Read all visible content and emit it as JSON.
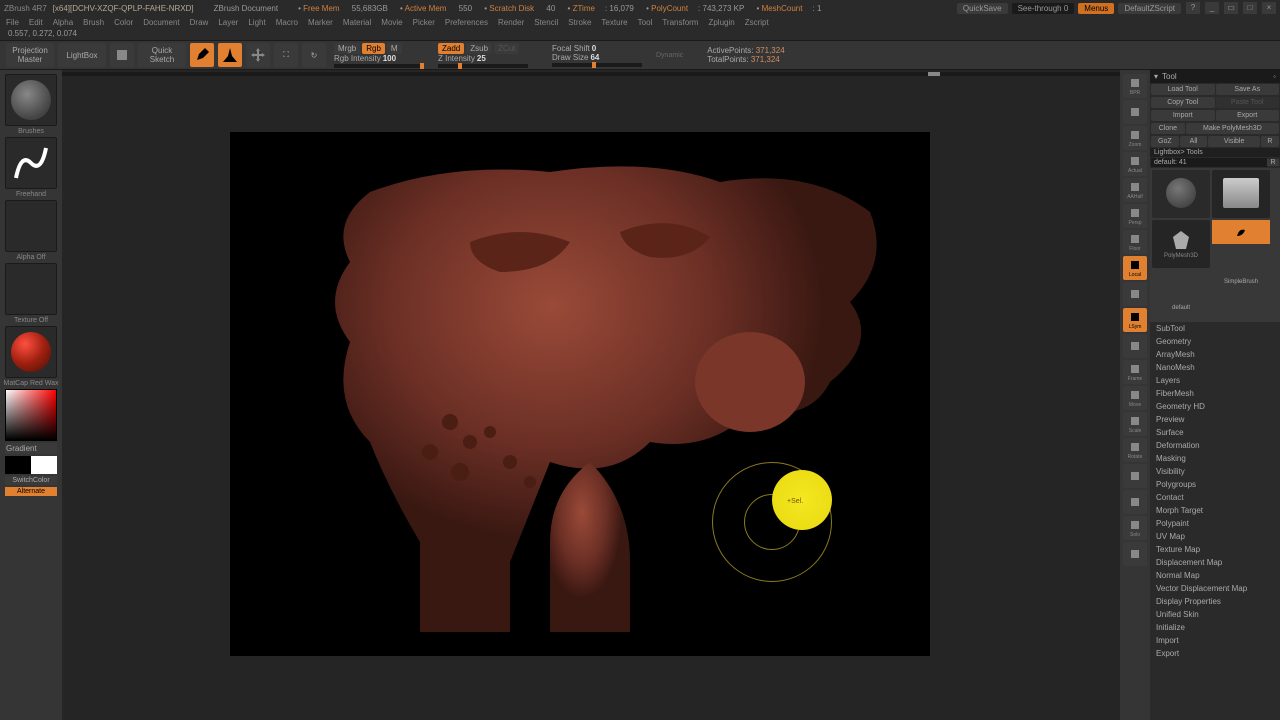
{
  "titlebar": {
    "app": "ZBrush 4R7",
    "file": "[x64][DCHV-XZQF-QPLP-FAHE-NRXD]",
    "docname": "ZBrush Document",
    "stats": {
      "freemem_lbl": "Free Mem",
      "freemem": "55,683GB",
      "activemem_lbl": "Active Mem",
      "activemem": "550",
      "scratch_lbl": "Scratch Disk",
      "scratch": "40",
      "ztime_lbl": "ZTime",
      "ztime": "16,079",
      "polycount_lbl": "PolyCount",
      "polycount": "743,273 KP",
      "meshcount_lbl": "MeshCount",
      "meshcount": "1"
    },
    "right": {
      "quicksave": "QuickSave",
      "seethrough": "See-through",
      "seethrough_val": "0",
      "menus": "Menus",
      "script": "DefaultZScript"
    }
  },
  "menus": [
    "File",
    "Edit",
    "Alpha",
    "Brush",
    "Color",
    "Document",
    "Draw",
    "Layer",
    "Light",
    "Macro",
    "Marker",
    "Material",
    "Movie",
    "Picker",
    "Preferences",
    "Render",
    "Stencil",
    "Stroke",
    "Texture",
    "Tool",
    "Transform",
    "Zplugin",
    "Zscript"
  ],
  "coords": "0.557, 0.272, 0.074",
  "shelf": {
    "projection": "Projection\nMaster",
    "lightbox": "LightBox",
    "quicksketch": "Quick\nSketch",
    "edit": "Edit",
    "draw": "Draw",
    "move": "Move",
    "scale": "Scale",
    "rotate": "Rotate",
    "mrgb": "Mrgb",
    "rgb": "Rgb",
    "m": "M",
    "rgbint_lbl": "Rgb Intensity",
    "rgbint": "100",
    "zadd": "Zadd",
    "zsub": "Zsub",
    "zcut": "ZCut",
    "zint_lbl": "Z Intensity",
    "zint": "25",
    "focal_lbl": "Focal Shift",
    "focal": "0",
    "drawsize_lbl": "Draw Size",
    "drawsize": "64",
    "dynamic": "Dynamic",
    "active_lbl": "ActivePoints:",
    "active": "371,324",
    "total_lbl": "TotalPoints:",
    "total": "371,324"
  },
  "left": {
    "brushes": "Brushes",
    "freehand": "Freehand",
    "alpha": "Alpha Off",
    "texture": "Texture Off",
    "material": "MatCap Red Wax",
    "gradient": "Gradient",
    "switchcolor": "SwitchColor",
    "alternate": "Alternate"
  },
  "viewbar": [
    "BPR",
    "",
    "Zoom",
    "Actual",
    "AAHalf",
    "Persp",
    "Floor",
    "Local",
    "",
    "LSym",
    "",
    "Frame",
    "Move",
    "Scale",
    "Rotate",
    "",
    "",
    "Solo",
    ""
  ],
  "right": {
    "title": "Tool",
    "loadtool": "Load Tool",
    "saveas": "Save As",
    "copytool": "Copy Tool",
    "pastetool": "Paste Tool",
    "import": "Import",
    "export": "Export",
    "clone": "Clone",
    "makepoly": "Make PolyMesh3D",
    "goz": "GoZ",
    "all": "All",
    "visible": "Visible",
    "r": "R",
    "lightbox": "Lightbox> Tools",
    "default": "default: 41",
    "thumbs": {
      "simplebrush": "SimpleBrush",
      "default_t": "default",
      "poly": "PolyMesh3D",
      "cyl": "Cylinder3D"
    },
    "sections": [
      "SubTool",
      "Geometry",
      "ArrayMesh",
      "NanoMesh",
      "Layers",
      "FiberMesh",
      "Geometry HD",
      "Preview",
      "Surface",
      "Deformation",
      "Masking",
      "Visibility",
      "Polygroups",
      "Contact",
      "Morph Target",
      "Polypaint",
      "UV Map",
      "Texture Map",
      "Displacement Map",
      "Normal Map",
      "Vector Displacement Map",
      "Display Properties",
      "Unified Skin",
      "Initialize",
      "Import",
      "Export"
    ]
  },
  "cursor_label": "+Sel."
}
